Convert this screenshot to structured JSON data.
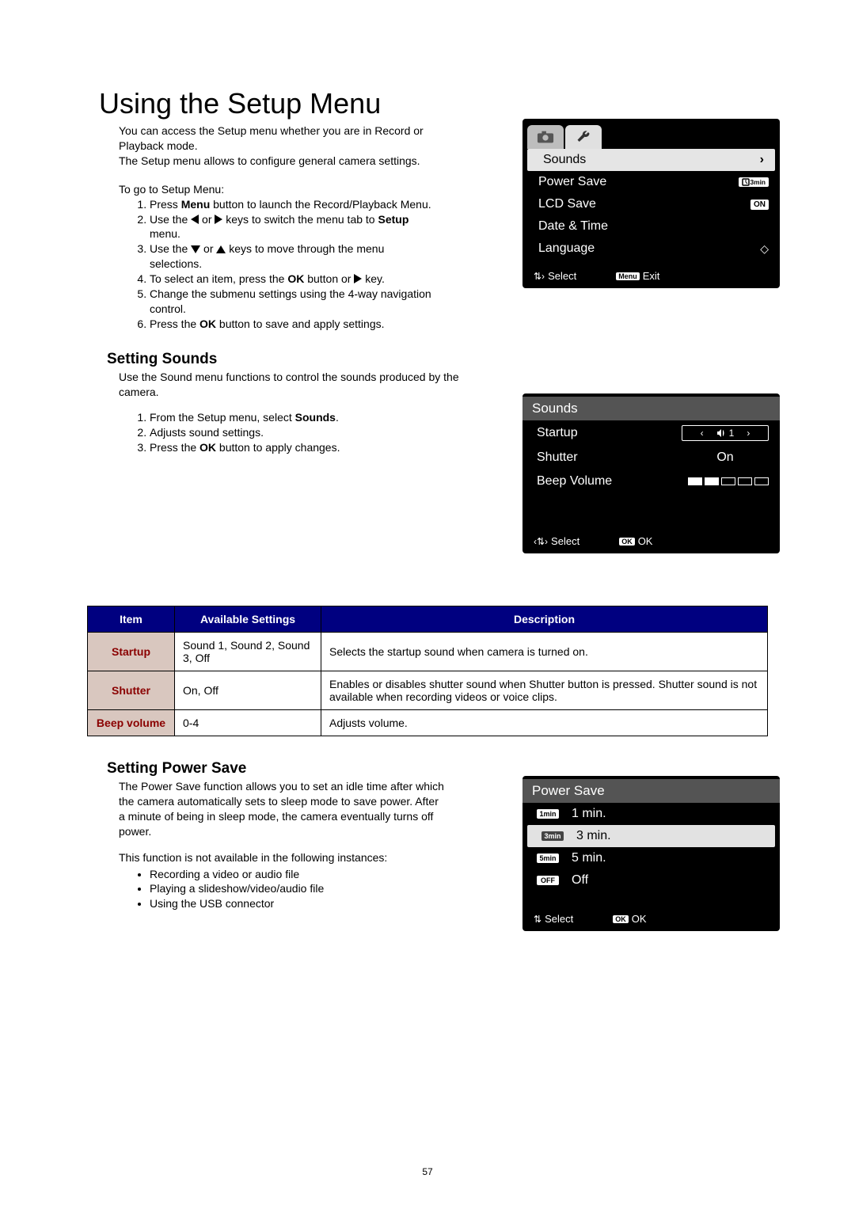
{
  "page_number": "57",
  "title": "Using the Setup Menu",
  "intro_lines": [
    "You can access the Setup menu whether you are in Record or Playback mode.",
    "The Setup menu allows to configure general camera settings."
  ],
  "goto_heading": "To go to Setup Menu:",
  "goto_steps": {
    "s1a": "Press ",
    "s1b": "Menu",
    "s1c": " button to launch the Record/Playback Menu.",
    "s2a": "Use the ",
    "s2b": " or ",
    "s2c": " keys to switch the menu tab to ",
    "s2d": "Setup",
    "s2e": "menu.",
    "s3a": "Use the ",
    "s3b": " or ",
    "s3c": " keys to move through the menu",
    "s3d": "selections.",
    "s4a": "To select an item, press the ",
    "s4b": "OK",
    "s4c": " button or ",
    "s4d": " key.",
    "s5": "Change the submenu settings using the 4-way navigation control.",
    "s6a": "Press the ",
    "s6b": "OK",
    "s6c": " button to save and apply settings."
  },
  "setup_lcd": {
    "items": [
      "Sounds",
      "Power Save",
      "LCD Save",
      "Date & Time",
      "Language"
    ],
    "power_save_badge": "3min",
    "lcd_save_badge": "ON",
    "footer_select": "Select",
    "footer_exit_key": "Menu",
    "footer_exit": "Exit"
  },
  "sounds_section": {
    "heading": "Setting Sounds",
    "desc": "Use the Sound menu functions to control the sounds produced by the camera.",
    "steps": {
      "s1a": "From the Setup menu, select ",
      "s1b": "Sounds",
      "s1c": ".",
      "s2": "Adjusts sound settings.",
      "s3a": "Press the ",
      "s3b": "OK",
      "s3c": " button to apply changes."
    }
  },
  "sounds_lcd": {
    "title": "Sounds",
    "rows": {
      "startup": "Startup",
      "startup_val": "1",
      "shutter": "Shutter",
      "shutter_val": "On",
      "beep": "Beep Volume",
      "beep_level": 2,
      "beep_max": 5
    },
    "footer_select": "Select",
    "footer_ok_key": "OK",
    "footer_ok": "OK"
  },
  "table": {
    "headers": [
      "Item",
      "Available Settings",
      "Description"
    ],
    "rows": [
      {
        "item": "Startup",
        "avail": "Sound 1, Sound 2, Sound 3, Off",
        "desc": "Selects the startup sound when camera is turned on."
      },
      {
        "item": "Shutter",
        "avail": "On, Off",
        "desc": "Enables or disables shutter sound when Shutter button is pressed. Shutter sound is not available when recording videos or voice clips."
      },
      {
        "item": "Beep volume",
        "avail": "0-4",
        "desc": "Adjusts volume."
      }
    ]
  },
  "power_section": {
    "heading": "Setting Power Save",
    "para": "The Power Save function allows you to set an idle time after which the camera automatically sets to sleep mode to save power. After a minute of being in sleep mode, the camera eventually turns off power.",
    "note": "This function is not available in the following instances:",
    "bullets": [
      "Recording a video or audio file",
      "Playing a slideshow/video/audio file",
      "Using the USB connector"
    ]
  },
  "power_lcd": {
    "title": "Power Save",
    "options": [
      {
        "icon": "1min",
        "label": "1 min."
      },
      {
        "icon": "3min",
        "label": "3 min."
      },
      {
        "icon": "5min",
        "label": "5 min."
      },
      {
        "icon": "OFF",
        "label": "Off"
      }
    ],
    "selected_index": 1,
    "footer_select": "Select",
    "footer_ok_key": "OK",
    "footer_ok": "OK"
  }
}
